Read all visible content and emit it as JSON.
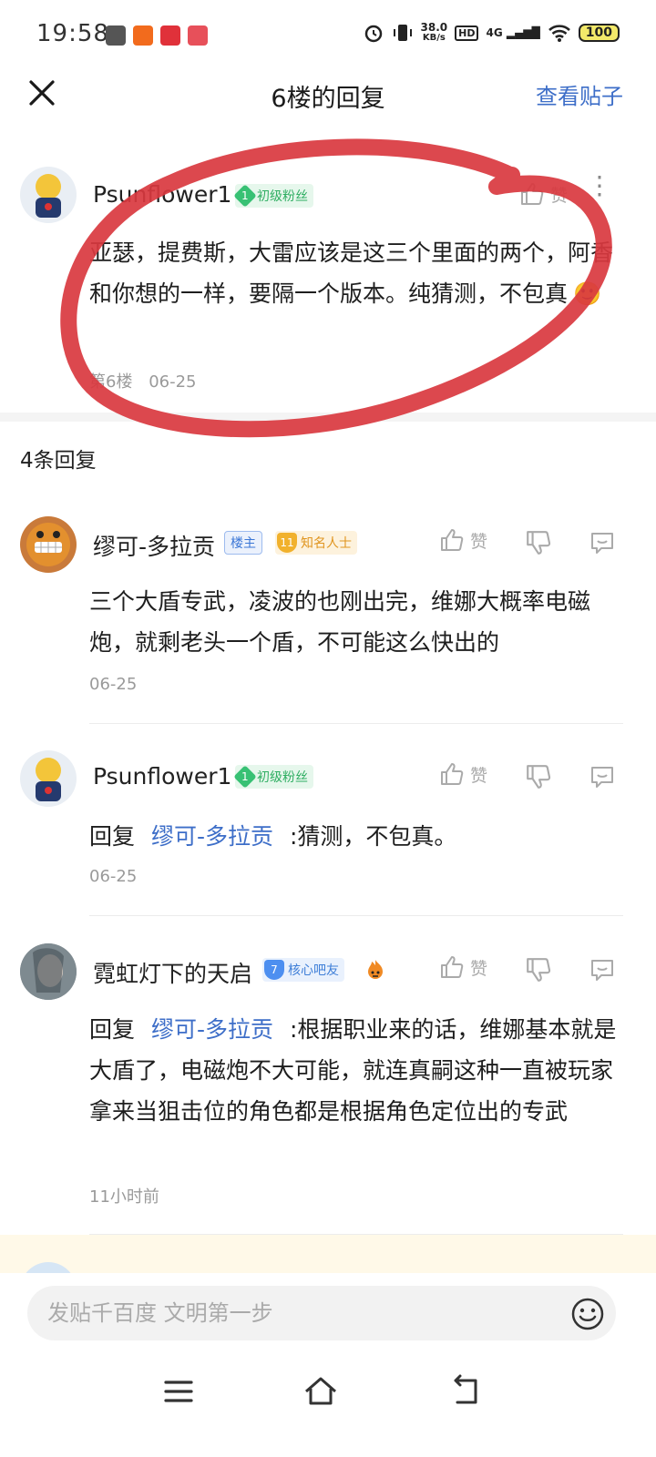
{
  "status_bar": {
    "time": "19:58",
    "net_speed_value": "38.0",
    "net_speed_unit": "KB/s",
    "hd_label": "HD",
    "signal_label": "4G",
    "battery": "100"
  },
  "header": {
    "title": "6楼的回复",
    "view_post_label": "查看贴子"
  },
  "main_post": {
    "username": "Psunflower1",
    "badge_level": "1",
    "badge_label": "初级粉丝",
    "like_label": "赞",
    "content": "亚瑟，提费斯，大雷应该是这三个里面的两个，阿香和你想的一样，要隔一个版本。纯猜测，不包真",
    "emoji": "🙂",
    "floor": "第6楼",
    "date": "06-25"
  },
  "replies_header": "4条回复",
  "replies": [
    {
      "username": "缪可-多拉贡",
      "owner_badge": "楼主",
      "badge_level": "11",
      "badge_label": "知名人士",
      "like_label": "赞",
      "content": "三个大盾专武，凌波的也刚出完，维娜大概率电磁炮，就剩老头一个盾，不可能这么快出的",
      "time": "06-25"
    },
    {
      "username": "Psunflower1",
      "badge_level": "1",
      "badge_label": "初级粉丝",
      "like_label": "赞",
      "reply_prefix": "回复",
      "reply_to": "缪可-多拉贡",
      "content": ":猜测，不包真。",
      "time": "06-25"
    },
    {
      "username": "霓虹灯下的天启",
      "badge_level": "7",
      "badge_label": "核心吧友",
      "like_label": "赞",
      "reply_prefix": "回复",
      "reply_to": "缪可-多拉贡",
      "content": ":根据职业来的话，维娜基本就是大盾了，电磁炮不大可能，就连真嗣这种一直被玩家拿来当狙击位的角色都是根据角色定位出的专武",
      "time": "11小时前"
    }
  ],
  "input": {
    "placeholder": "发贴千百度 文明第一步"
  },
  "colors": {
    "accent_blue": "#3d6ec8",
    "annotation_red": "#d9383f",
    "fan_green": "#2fae62"
  }
}
